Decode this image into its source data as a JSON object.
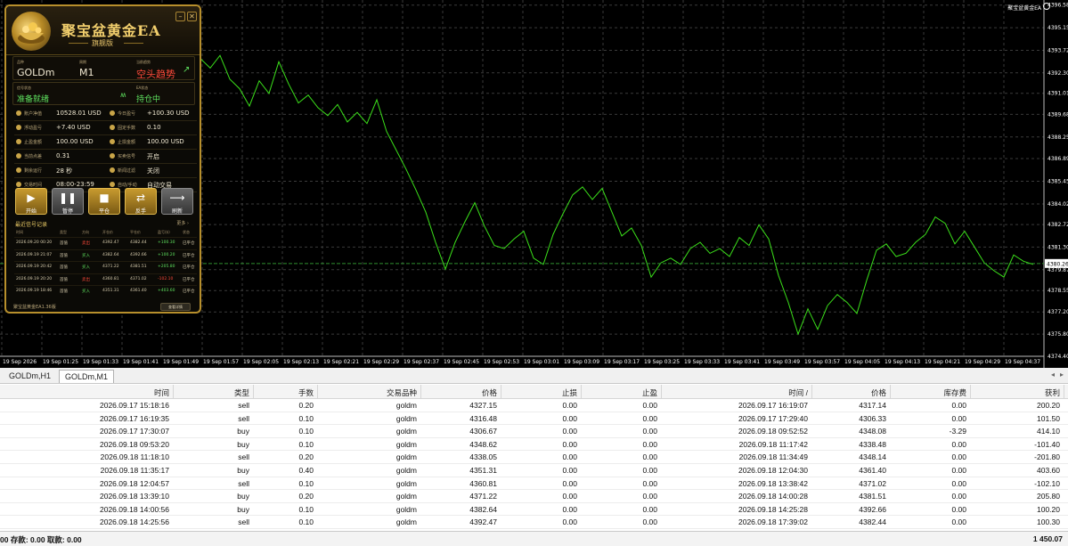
{
  "chart": {
    "symbol_label": "聚宝盆黄金EA",
    "symbol": "GOLDm",
    "timeframe": "M1",
    "price_labels": [
      "4396.58",
      "4395.15",
      "4393.72",
      "4392.30",
      "4391.01",
      "4389.68",
      "4388.25",
      "4386.89",
      "4385.45",
      "4384.02",
      "4382.72",
      "4381.30",
      "4380.26",
      "4379.87",
      "4378.55",
      "4377.20",
      "4375.80",
      "4374.40"
    ],
    "current_price": "4380.26",
    "time_labels": [
      "19 Sep 2026",
      "19 Sep 01:25",
      "19 Sep 01:33",
      "19 Sep 01:41",
      "19 Sep 01:49",
      "19 Sep 01:57",
      "19 Sep 02:05",
      "19 Sep 02:13",
      "19 Sep 02:21",
      "19 Sep 02:29",
      "19 Sep 02:37",
      "19 Sep 02:45",
      "19 Sep 02:53",
      "19 Sep 03:01",
      "19 Sep 03:09",
      "19 Sep 03:17",
      "19 Sep 03:25",
      "19 Sep 03:33",
      "19 Sep 03:41",
      "19 Sep 03:49",
      "19 Sep 03:57",
      "19 Sep 04:05",
      "19 Sep 04:13",
      "19 Sep 04:21",
      "19 Sep 04:29",
      "19 Sep 04:37"
    ],
    "line_color": "#3be01a",
    "grid_color": "#3a3a3a"
  },
  "chart_data": {
    "type": "line",
    "title": "",
    "xlabel": "",
    "ylabel": "",
    "ylim": [
      4374.4,
      4396.9
    ],
    "x": [
      "01:49",
      "01:51",
      "01:53",
      "01:55",
      "01:57",
      "01:59",
      "02:01",
      "02:03",
      "02:05",
      "02:07",
      "02:09",
      "02:11",
      "02:13",
      "02:15",
      "02:17",
      "02:19",
      "02:21",
      "02:23",
      "02:25",
      "02:27",
      "02:29",
      "02:31",
      "02:33",
      "02:35",
      "02:37",
      "02:39",
      "02:41",
      "02:43",
      "02:45",
      "02:47",
      "02:49",
      "02:51",
      "02:53",
      "02:55",
      "02:57",
      "02:59",
      "03:01",
      "03:03",
      "03:05",
      "03:07",
      "03:09",
      "03:11",
      "03:13",
      "03:15",
      "03:17",
      "03:19",
      "03:21",
      "03:23",
      "03:25",
      "03:27",
      "03:29",
      "03:31",
      "03:33",
      "03:35",
      "03:37",
      "03:39",
      "03:41",
      "03:43",
      "03:45",
      "03:47",
      "03:49",
      "03:51",
      "03:53",
      "03:55",
      "03:57",
      "03:59",
      "04:01",
      "04:03",
      "04:05",
      "04:07",
      "04:09",
      "04:11",
      "04:13",
      "04:15",
      "04:17",
      "04:19",
      "04:21",
      "04:23",
      "04:25",
      "04:27",
      "04:29",
      "04:31",
      "04:33",
      "04:35",
      "04:37",
      "04:39"
    ],
    "series": [
      {
        "values": [
          4393.2,
          4392.6,
          4393.4,
          4391.9,
          4391.3,
          4390.2,
          4391.8,
          4391.0,
          4393.0,
          4391.6,
          4390.4,
          4390.9,
          4390.1,
          4389.6,
          4390.3,
          4389.2,
          4389.8,
          4389.1,
          4390.6,
          4388.6,
          4387.4,
          4386.2,
          4384.9,
          4383.5,
          4381.6,
          4379.9,
          4381.6,
          4382.9,
          4384.1,
          4382.6,
          4381.4,
          4381.2,
          4381.8,
          4382.3,
          4380.6,
          4380.2,
          4382.1,
          4383.4,
          4384.6,
          4385.1,
          4384.3,
          4385.0,
          4383.5,
          4382.0,
          4382.5,
          4381.4,
          4379.4,
          4380.3,
          4380.6,
          4380.2,
          4381.2,
          4381.6,
          4380.9,
          4381.2,
          4380.7,
          4381.9,
          4381.4,
          4382.7,
          4381.8,
          4379.5,
          4377.8,
          4375.8,
          4377.4,
          4376.1,
          4377.6,
          4378.3,
          4377.8,
          4377.1,
          4379.2,
          4381.1,
          4381.5,
          4380.7,
          4380.9,
          4381.6,
          4382.1,
          4383.2,
          4382.8,
          4381.5,
          4382.3,
          4381.3,
          4380.3,
          4379.8,
          4379.4,
          4380.8,
          4380.4,
          4380.2
        ]
      }
    ]
  },
  "ea": {
    "name": "聚宝盆黄金EA",
    "edition": "旗舰版",
    "minimize": "–",
    "close": "✕",
    "product_label": "品种",
    "product": "GOLDm",
    "period_label": "周期",
    "period": "M1",
    "trend_label": "当前趋势",
    "trend": "空头趋势",
    "signal_label": "信号状态",
    "signal": "准备就绪",
    "ea_state_label": "EA状态",
    "ea_state": "持仓中",
    "rows": [
      {
        "l1": "账户净值",
        "v1": "10528.01 USD",
        "l2": "今日盈亏",
        "v2": "+100.30 USD"
      },
      {
        "l1": "浮动盈亏",
        "v1": "+7.40 USD",
        "l2": "固定手数",
        "v2": "0.10"
      },
      {
        "l1": "止盈金额",
        "v1": "100.00 USD",
        "l2": "止损金额",
        "v2": "100.00 USD"
      },
      {
        "l1": "当前点差",
        "v1": "0.31",
        "l2": "买卖信号",
        "v2": "开启"
      },
      {
        "l1": "剩余运行",
        "v1": "28 秒",
        "l2": "新闻过滤",
        "v2": "关闭"
      },
      {
        "l1": "交易时间",
        "v1": "08:00-23:59",
        "l2": "自动/手动",
        "v2": "自动交易"
      }
    ],
    "buttons": [
      {
        "icon": "▶",
        "label": "开始"
      },
      {
        "icon": "❚❚",
        "label": "暂停"
      },
      {
        "icon": "■",
        "label": "平仓"
      },
      {
        "icon": "⇄",
        "label": "反手"
      },
      {
        "icon": "⟶",
        "label": "刷新"
      }
    ],
    "signals_title": "最近信号记录",
    "signals_more": "更多 ›",
    "signal_headers": [
      "时间",
      "类型",
      "方向",
      "开仓价",
      "平仓价",
      "盈亏($)",
      "状态"
    ],
    "signals": [
      {
        "time": "2026.09.20 00:20",
        "type": "首值",
        "dir": "卖出",
        "open": "4392.47",
        "close": "4382.44",
        "pnl": "+100.30",
        "status": "已平仓"
      },
      {
        "time": "2026.09.19 21:07",
        "type": "首值",
        "dir": "买入",
        "open": "4382.64",
        "close": "4392.66",
        "pnl": "+100.20",
        "status": "已平仓"
      },
      {
        "time": "2026.09.19 20:42",
        "type": "首值",
        "dir": "买入",
        "open": "4371.22",
        "close": "4381.51",
        "pnl": "+205.80",
        "status": "已平仓"
      },
      {
        "time": "2026.09.19 20:20",
        "type": "首值",
        "dir": "卖出",
        "open": "4360.81",
        "close": "4371.02",
        "pnl": "-102.10",
        "status": "已平仓"
      },
      {
        "time": "2026.09.19 18:46",
        "type": "首值",
        "dir": "买入",
        "open": "4351.31",
        "close": "4361.40",
        "pnl": "+403.60",
        "status": "已平仓"
      }
    ],
    "footer": "聚宝盆黄金EA1.36版",
    "footer_btn": "查看详情"
  },
  "tabs": [
    {
      "label": "GOLDm,H1"
    },
    {
      "label": "GOLDm,M1"
    }
  ],
  "table": {
    "headers": [
      "时间",
      "类型",
      "手数",
      "交易品种",
      "价格",
      "止损",
      "止盈",
      "时间 /",
      "价格",
      "库存费",
      "获利"
    ],
    "rows": [
      [
        "2026.09.17 15:18:16",
        "sell",
        "0.20",
        "goldm",
        "4327.15",
        "0.00",
        "0.00",
        "2026.09.17 16:19:07",
        "4317.14",
        "0.00",
        "200.20"
      ],
      [
        "2026.09.17 16:19:35",
        "sell",
        "0.10",
        "goldm",
        "4316.48",
        "0.00",
        "0.00",
        "2026.09.17 17:29:40",
        "4306.33",
        "0.00",
        "101.50"
      ],
      [
        "2026.09.17 17:30:07",
        "buy",
        "0.10",
        "goldm",
        "4306.67",
        "0.00",
        "0.00",
        "2026.09.18 09:52:52",
        "4348.08",
        "-3.29",
        "414.10"
      ],
      [
        "2026.09.18 09:53:20",
        "buy",
        "0.10",
        "goldm",
        "4348.62",
        "0.00",
        "0.00",
        "2026.09.18 11:17:42",
        "4338.48",
        "0.00",
        "-101.40"
      ],
      [
        "2026.09.18 11:18:10",
        "sell",
        "0.20",
        "goldm",
        "4338.05",
        "0.00",
        "0.00",
        "2026.09.18 11:34:49",
        "4348.14",
        "0.00",
        "-201.80"
      ],
      [
        "2026.09.18 11:35:17",
        "buy",
        "0.40",
        "goldm",
        "4351.31",
        "0.00",
        "0.00",
        "2026.09.18 12:04:30",
        "4361.40",
        "0.00",
        "403.60"
      ],
      [
        "2026.09.18 12:04:57",
        "sell",
        "0.10",
        "goldm",
        "4360.81",
        "0.00",
        "0.00",
        "2026.09.18 13:38:42",
        "4371.02",
        "0.00",
        "-102.10"
      ],
      [
        "2026.09.18 13:39:10",
        "buy",
        "0.20",
        "goldm",
        "4371.22",
        "0.00",
        "0.00",
        "2026.09.18 14:00:28",
        "4381.51",
        "0.00",
        "205.80"
      ],
      [
        "2026.09.18 14:00:56",
        "buy",
        "0.10",
        "goldm",
        "4382.64",
        "0.00",
        "0.00",
        "2026.09.18 14:25:28",
        "4392.66",
        "0.00",
        "100.20"
      ],
      [
        "2026.09.18 14:25:56",
        "sell",
        "0.10",
        "goldm",
        "4392.47",
        "0.00",
        "0.00",
        "2026.09.18 17:39:02",
        "4382.44",
        "0.00",
        "100.30"
      ]
    ]
  },
  "status": {
    "left": "00  存款: 0.00  取款: 0.00",
    "right": "1 450.07"
  }
}
